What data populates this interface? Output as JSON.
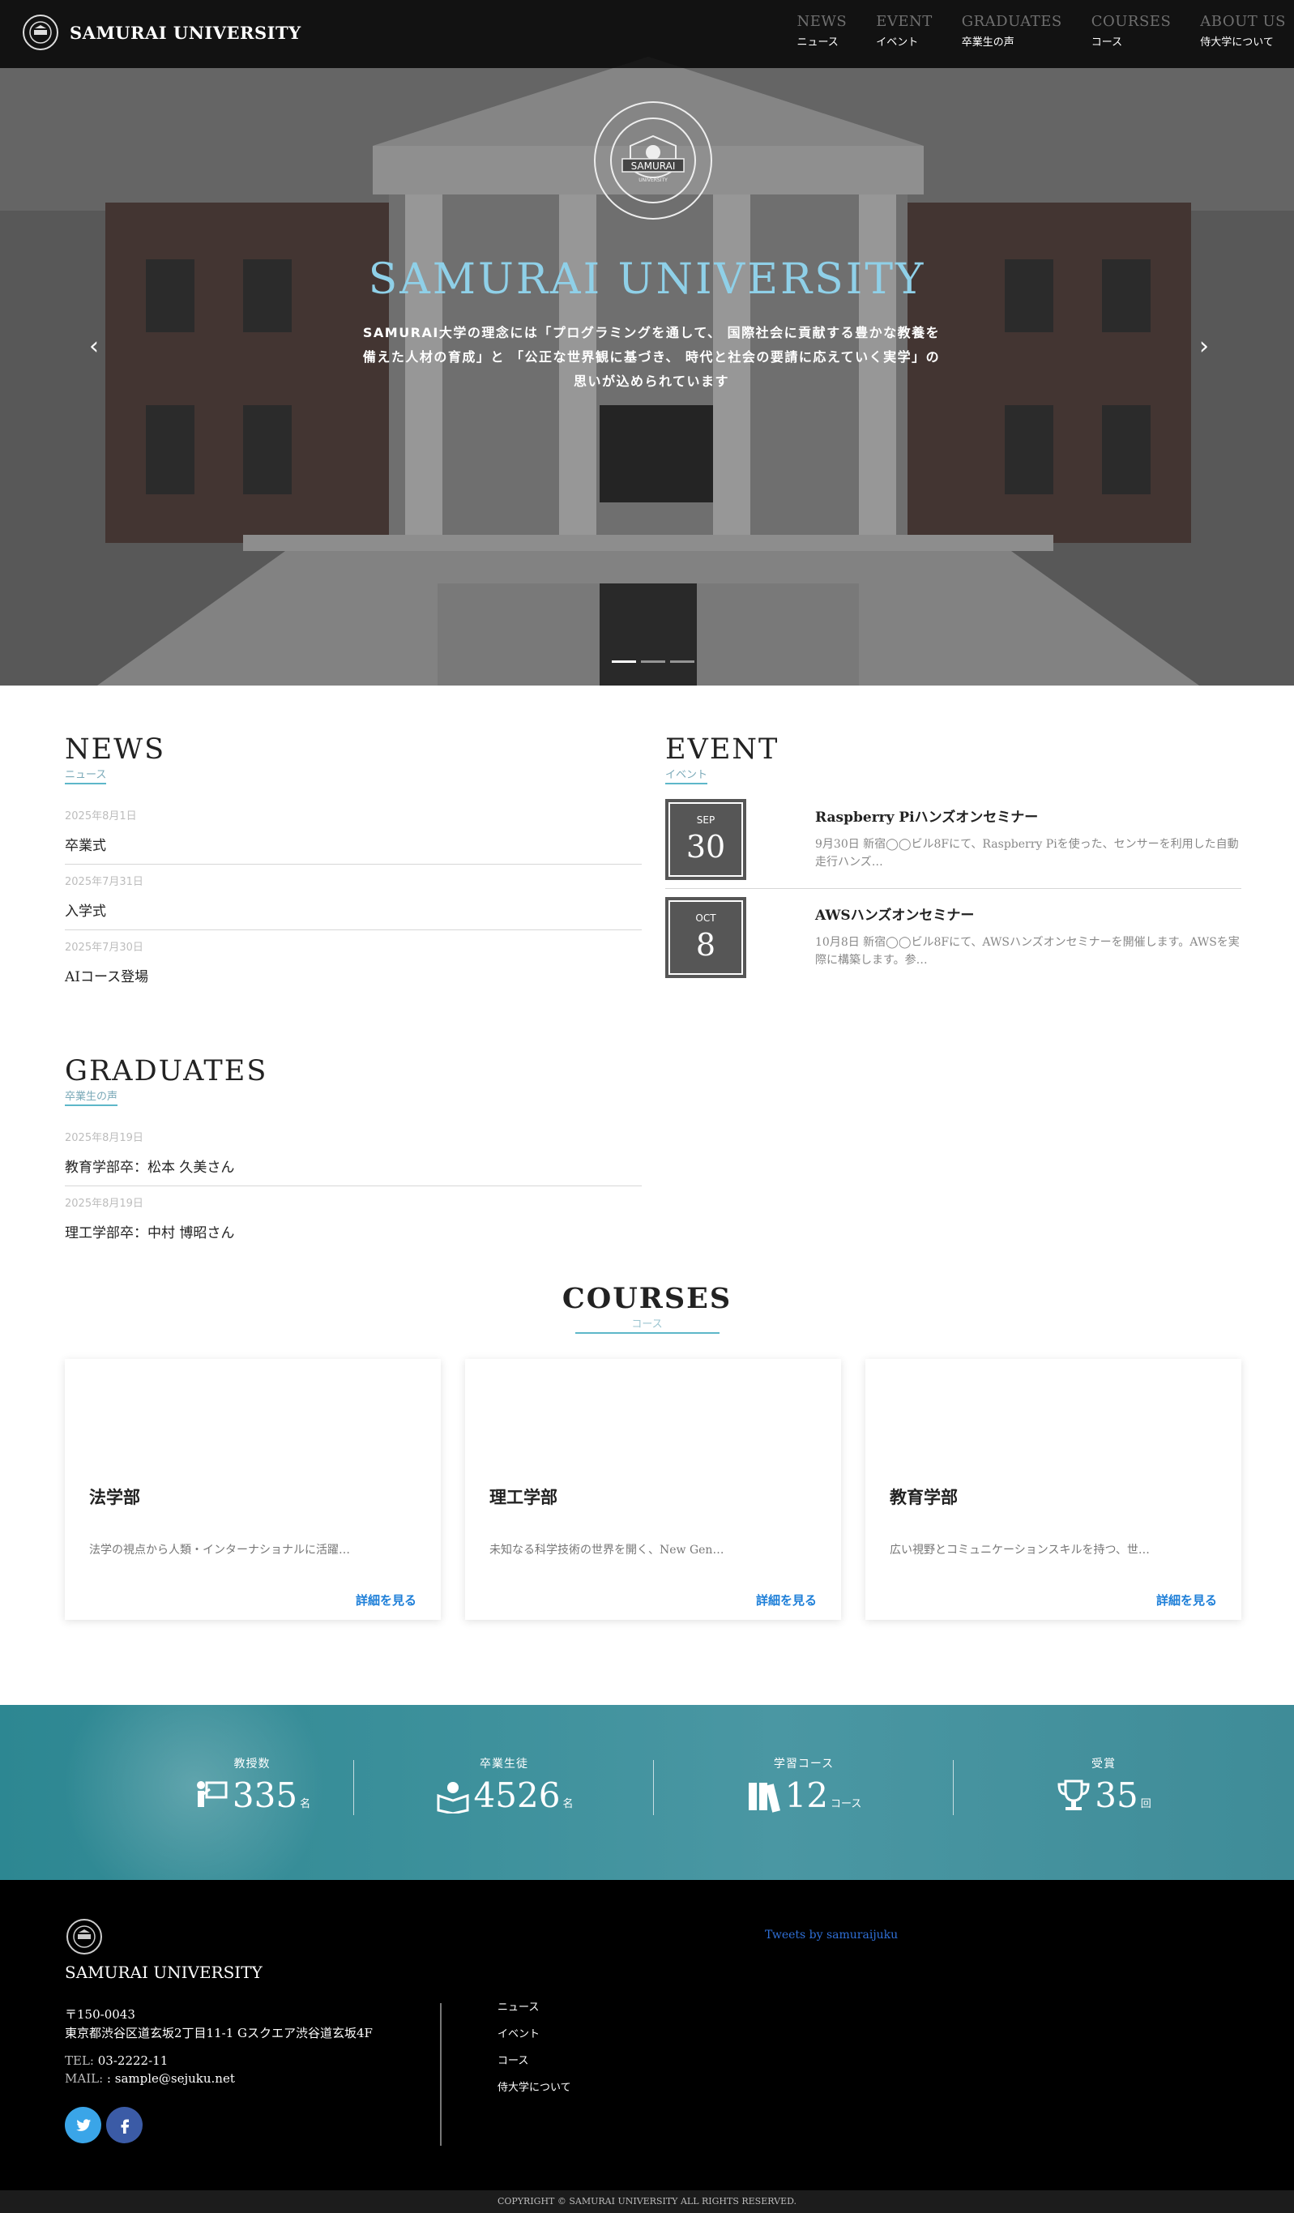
{
  "header": {
    "brand": "SAMURAI UNIVERSITY",
    "nav": [
      {
        "en": "NEWS",
        "ja": "ニュース"
      },
      {
        "en": "EVENT",
        "ja": "イベント"
      },
      {
        "en": "GRADUATES",
        "ja": "卒業生の声"
      },
      {
        "en": "COURSES",
        "ja": "コース"
      },
      {
        "en": "ABOUT US",
        "ja": "侍大学について"
      }
    ]
  },
  "hero": {
    "crest_text": "SAMURAI",
    "crest_sub": "UNIVERSITY",
    "title": "SAMURAI UNIVERSITY",
    "text": "SAMURAI大学の理念には「プログラミングを通して、 国際社会に貢献する豊かな教養を備えた人材の育成」と 「公正な世界観に基づき、 時代と社会の要請に応えていく実学」の思いが込められています",
    "prev": "‹",
    "next": "›"
  },
  "news": {
    "title": "NEWS",
    "sub": "ニュース",
    "items": [
      {
        "date": "2025年8月1日",
        "title": "卒業式"
      },
      {
        "date": "2025年7月31日",
        "title": "入学式"
      },
      {
        "date": "2025年7月30日",
        "title": "AIコース登場"
      }
    ]
  },
  "event": {
    "title": "EVENT",
    "sub": "イベント",
    "items": [
      {
        "month": "SEP",
        "day": "30",
        "title": "Raspberry Piハンズオンセミナー",
        "desc": "9月30日 新宿◯◯ビル8Fにて、Raspberry Piを使った、センサーを利用した自動走行ハンズ…"
      },
      {
        "month": "OCT",
        "day": "8",
        "title": "AWSハンズオンセミナー",
        "desc": "10月8日 新宿◯◯ビル8Fにて、AWSハンズオンセミナーを開催します。AWSを実際に構築します。参…"
      }
    ]
  },
  "graduates": {
    "title": "GRADUATES",
    "sub": "卒業生の声",
    "items": [
      {
        "date": "2025年8月19日",
        "title": "教育学部卒：松本 久美さん"
      },
      {
        "date": "2025年8月19日",
        "title": "理工学部卒：中村 博昭さん"
      }
    ]
  },
  "courses": {
    "title": "COURSES",
    "sub": "コース",
    "items": [
      {
        "title": "法学部",
        "desc": "法学の視点から人類・インターナショナルに活躍…",
        "more": "詳細を見る"
      },
      {
        "title": "理工学部",
        "desc": "未知なる科学技術の世界を開く、New Gen…",
        "more": "詳細を見る"
      },
      {
        "title": "教育学部",
        "desc": "広い視野とコミュニケーションスキルを持つ、世…",
        "more": "詳細を見る"
      }
    ]
  },
  "stats": [
    {
      "label": "教授数",
      "num": "335",
      "unit": "名",
      "icon": "teacher-icon"
    },
    {
      "label": "卒業生徒",
      "num": "4526",
      "unit": "名",
      "icon": "reader-icon"
    },
    {
      "label": "学習コース",
      "num": "12",
      "unit": "コース",
      "icon": "books-icon"
    },
    {
      "label": "受賞",
      "num": "35",
      "unit": "回",
      "icon": "trophy-icon"
    }
  ],
  "footer": {
    "name": "SAMURAI UNIVERSITY",
    "zip": "〒150-0043",
    "address": "東京都渋谷区道玄坂2丁目11-1 Gスクエア渋谷道玄坂4F",
    "tel_label": "TEL:",
    "tel": "03-2222-11",
    "mail_label": "MAIL:",
    "mail": ": sample@sejuku.net",
    "links": [
      "ニュース",
      "イベント",
      "コース",
      "侍大学について"
    ],
    "tweets": "Tweets by samuraijuku",
    "copyright": "COPYRIGHT © SAMURAI UNIVERSITY ALL RIGHTS RESERVED."
  },
  "colors": {
    "accent": "#5db7c9",
    "hero_title": "#8fd0e8",
    "link": "#1e7fd8",
    "stats_bg": "#3a8f9a"
  }
}
